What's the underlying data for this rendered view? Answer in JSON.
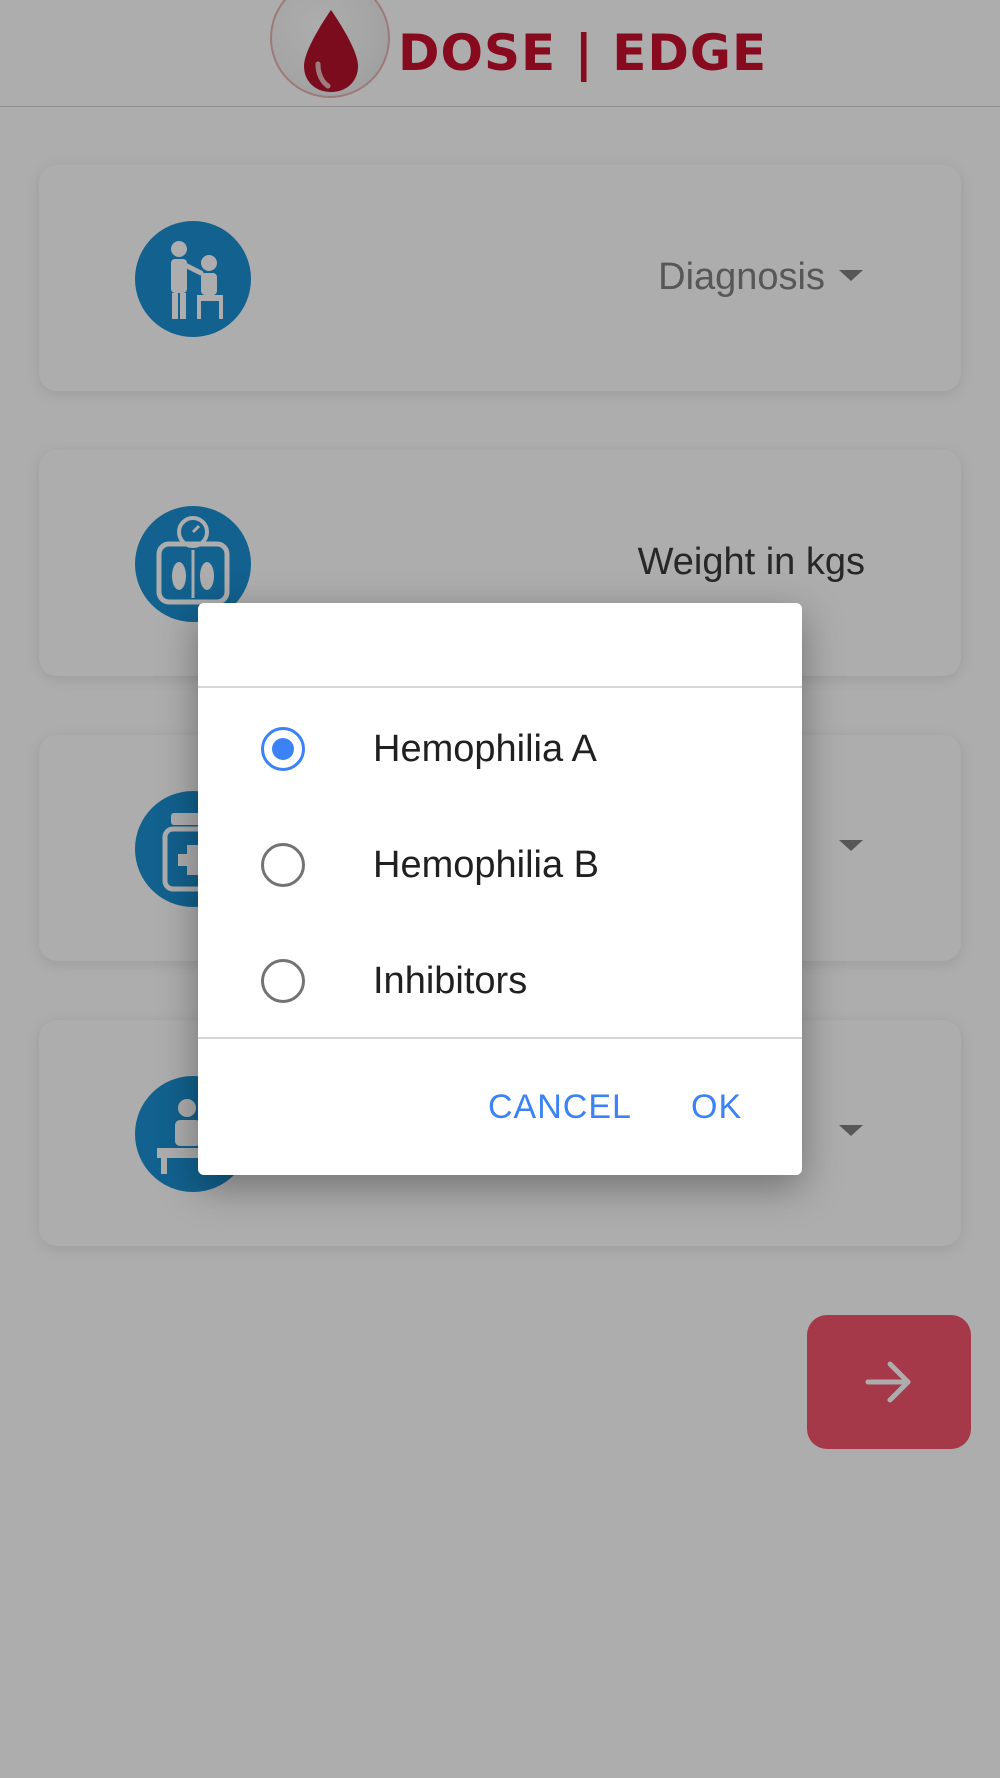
{
  "header": {
    "logo_text": "DOSE | EDGE",
    "brand_color": "#c8102e"
  },
  "cards": [
    {
      "label": "Diagnosis",
      "icon": "doctor-patient-icon",
      "has_dropdown": true
    },
    {
      "label": "Weight in kgs",
      "icon": "weight-scale-icon",
      "has_dropdown": false
    },
    {
      "label": "",
      "icon": "medicine-bottle-icon",
      "has_dropdown": true
    },
    {
      "label": "",
      "icon": "treatment-icon",
      "has_dropdown": true
    }
  ],
  "next_button": {
    "icon": "arrow-right-icon",
    "color": "#f4546e"
  },
  "dialog": {
    "options": [
      {
        "label": "Hemophilia A",
        "selected": true
      },
      {
        "label": "Hemophilia B",
        "selected": false
      },
      {
        "label": "Inhibitors",
        "selected": false
      }
    ],
    "cancel_label": "CANCEL",
    "ok_label": "OK",
    "accent_color": "#3b82f6"
  }
}
